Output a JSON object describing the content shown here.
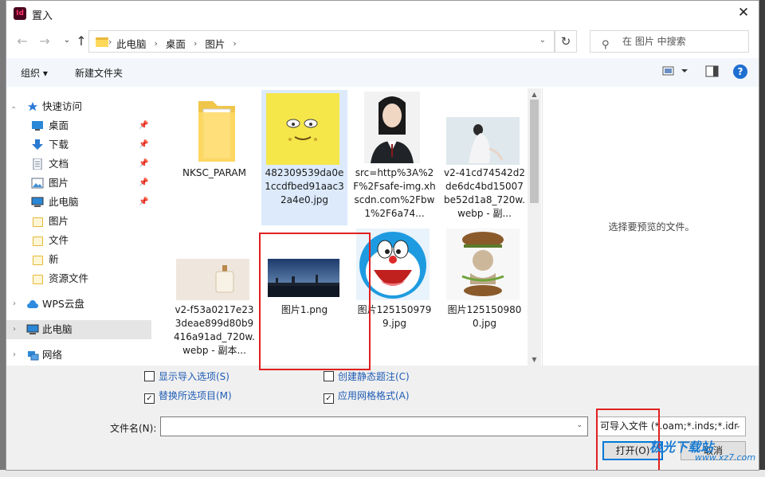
{
  "window": {
    "title": "置入",
    "app_icon_text": "Id",
    "close_glyph": "✕"
  },
  "nav": {
    "back": "←",
    "forward": "→",
    "up": "↑",
    "breadcrumb": [
      "此电脑",
      "桌面",
      "图片"
    ],
    "search_placeholder": "在 图片 中搜索"
  },
  "toolbar": {
    "organize": "组织 ▾",
    "new_folder": "新建文件夹",
    "help": "?"
  },
  "sidebar": [
    {
      "label": "快速访问",
      "icon": "star-icon",
      "chevron": "⌄",
      "pinned": false
    },
    {
      "label": "桌面",
      "icon": "desktop-icon",
      "pinned": true
    },
    {
      "label": "下载",
      "icon": "download-icon",
      "pinned": true
    },
    {
      "label": "文档",
      "icon": "document-icon",
      "pinned": true
    },
    {
      "label": "图片",
      "icon": "pictures-icon",
      "pinned": true
    },
    {
      "label": "此电脑",
      "icon": "computer-icon",
      "pinned": true
    },
    {
      "label": "图片",
      "icon": "folder-icon",
      "pinned": false
    },
    {
      "label": "文件",
      "icon": "folder-icon",
      "pinned": false
    },
    {
      "label": "新",
      "icon": "folder-icon",
      "pinned": false
    },
    {
      "label": "资源文件",
      "icon": "folder-icon",
      "pinned": false
    },
    {
      "label": "WPS云盘",
      "icon": "cloud-icon",
      "chevron": "›",
      "pinned": false
    },
    {
      "label": "此电脑",
      "icon": "computer-icon",
      "chevron": "›",
      "pinned": false,
      "selected": true
    },
    {
      "label": "网络",
      "icon": "network-icon",
      "chevron": "›",
      "pinned": false
    }
  ],
  "files": [
    {
      "name": "NKSC_PARAM",
      "kind": "folder"
    },
    {
      "name": "482309539da0e1ccdfbed91aac32a4e0.jpg",
      "kind": "spongebob",
      "selected": true
    },
    {
      "name": "src=http%3A%2F%2Fsafe-img.xhscdn.com%2Fbw1%2F6a74...",
      "kind": "portrait"
    },
    {
      "name": "v2-41cd74542d2de6dc4bd15007be52d1a8_720w.webp - 副...",
      "kind": "photo-woman"
    },
    {
      "name": "v2-f53a0217e233deae899d80b9416a91ad_720w.webp - 副本...",
      "kind": "perfume"
    },
    {
      "name": "图片1.png",
      "kind": "landscape"
    },
    {
      "name": "图片1251509799.jpg",
      "kind": "doraemon"
    },
    {
      "name": "图片1251509800.jpg",
      "kind": "burger-cat"
    }
  ],
  "preview": {
    "placeholder": "选择要预览的文件。"
  },
  "options": {
    "show_import": {
      "label": "显示导入选项(S)",
      "checked": false
    },
    "replace_selected": {
      "label": "替换所选项目(M)",
      "checked": true
    },
    "create_static_caption": {
      "label": "创建静态题注(C)",
      "checked": false
    },
    "apply_grid": {
      "label": "应用网格格式(A)",
      "checked": true
    }
  },
  "filename": {
    "label": "文件名(N):",
    "value": "",
    "dropdown": "⌄"
  },
  "filetype": {
    "value": "可导入文件 (*.oam;*.inds;*.idr",
    "dropdown": "⌄"
  },
  "buttons": {
    "open": "打开(O)",
    "cancel": "取消"
  },
  "watermark": {
    "text": "极光下载站",
    "sub": "www.xz7.com"
  },
  "colors": {
    "accent": "#0078d7",
    "highlight": "#e02020",
    "selection": "#dceafc"
  }
}
